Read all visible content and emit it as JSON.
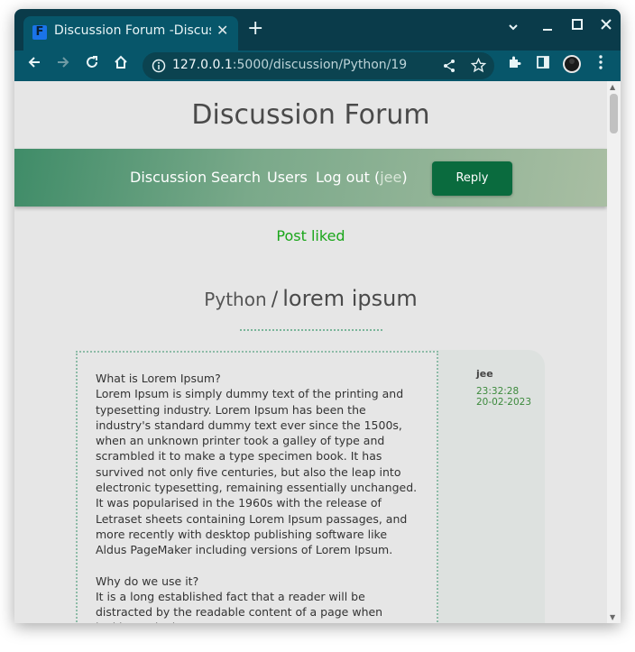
{
  "browser": {
    "tab_title": "Discussion Forum -Discussion",
    "favicon_letter": "F",
    "new_tab": "+",
    "close_tab": "✕",
    "url_host": "127.0.0.1",
    "url_rest": ":5000/discussion/Python/19"
  },
  "site": {
    "title": "Discussion Forum",
    "nav": {
      "discussion": "Discussion",
      "search": "Search",
      "users": "Users",
      "logout": "Log out",
      "open_paren": "(",
      "username": "jee",
      "close_paren": ")",
      "reply": "Reply"
    },
    "flash": "Post liked",
    "breadcrumb": {
      "category": "Python",
      "separator": "/",
      "topic": "lorem ipsum"
    }
  },
  "post": {
    "author": "jee",
    "time": "23:32:28",
    "date": "20-02-2023",
    "q1": "What is Lorem Ipsum?",
    "p1": "Lorem Ipsum is simply dummy text of the printing and typesetting industry. Lorem Ipsum has been the industry's standard dummy text ever since the 1500s, when an unknown printer took a galley of type and scrambled it to make a type specimen book. It has survived not only five centuries, but also the leap into electronic typesetting, remaining essentially unchanged. It was popularised in the 1960s with the release of Letraset sheets containing Lorem Ipsum passages, and more recently with desktop publishing software like Aldus PageMaker including versions of Lorem Ipsum.",
    "q2": "Why do we use it?",
    "p2": "It is a long established fact that a reader will be distracted by the readable content of a page when looking at its layout."
  },
  "icons": [
    "back-icon",
    "forward-icon",
    "reload-icon",
    "home-icon",
    "info-icon",
    "share-icon",
    "star-icon",
    "extensions-icon",
    "sidebar-icon",
    "avatar",
    "menu-icon"
  ]
}
